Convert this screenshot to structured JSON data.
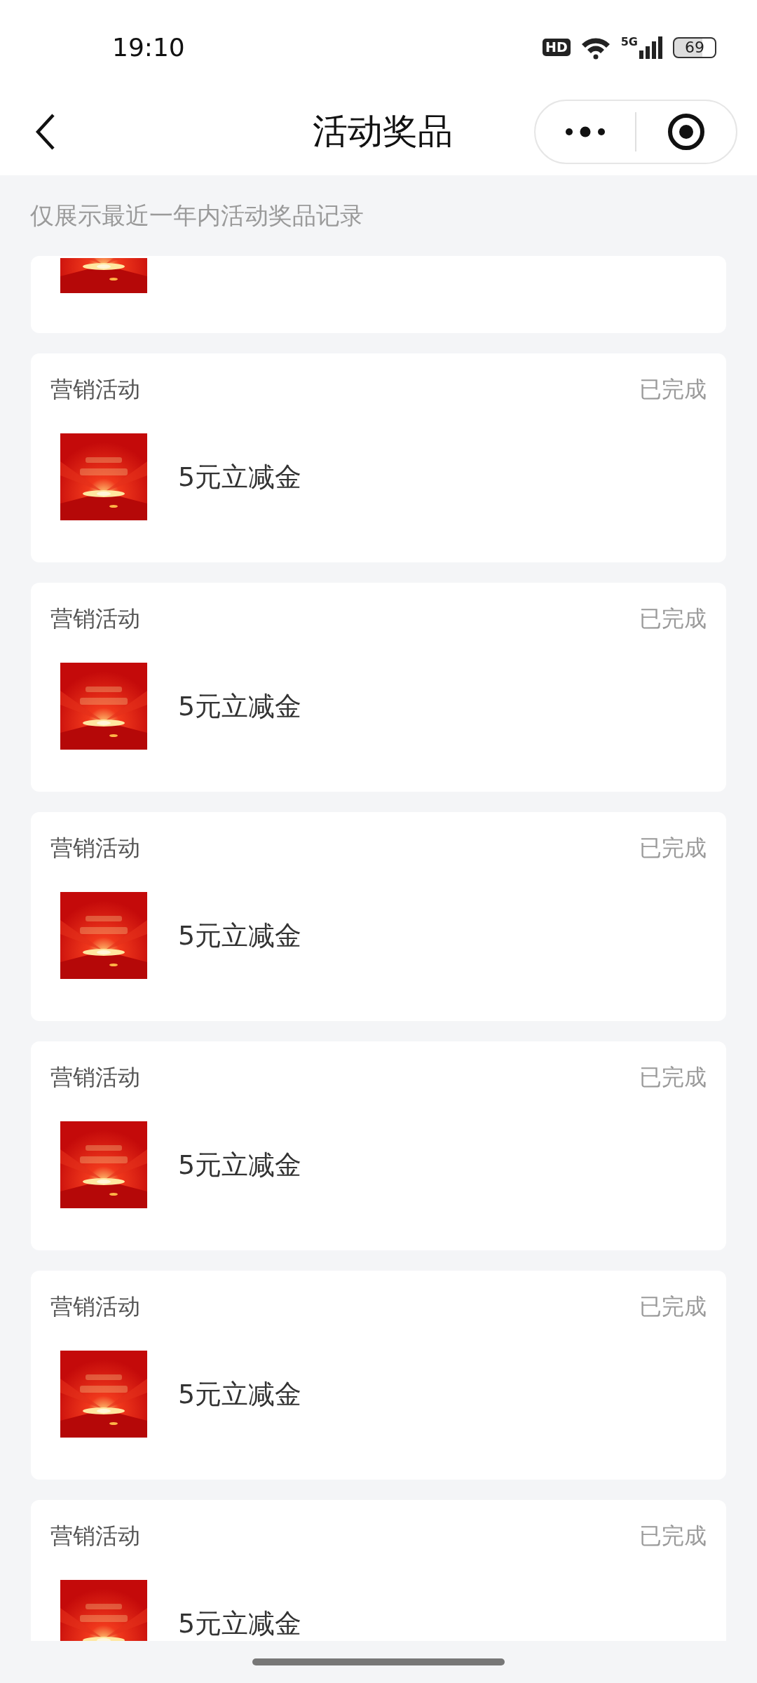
{
  "status_bar": {
    "time": "19:10",
    "hd_badge": "HD",
    "network": "5G",
    "battery": "69"
  },
  "nav_bar": {
    "title": "活动奖品"
  },
  "notice": "仅展示最近一年内活动奖品记录",
  "records": [
    {
      "kind": "clipped"
    },
    {
      "kind": "full",
      "category": "营销活动",
      "status": "已完成",
      "name": "5元立减金"
    },
    {
      "kind": "full",
      "category": "营销活动",
      "status": "已完成",
      "name": "5元立减金"
    },
    {
      "kind": "full",
      "category": "营销活动",
      "status": "已完成",
      "name": "5元立减金"
    },
    {
      "kind": "full",
      "category": "营销活动",
      "status": "已完成",
      "name": "5元立减金"
    },
    {
      "kind": "full",
      "category": "营销活动",
      "status": "已完成",
      "name": "5元立减金"
    },
    {
      "kind": "full",
      "category": "营销活动",
      "status": "已完成",
      "name": "5元立减金"
    }
  ]
}
